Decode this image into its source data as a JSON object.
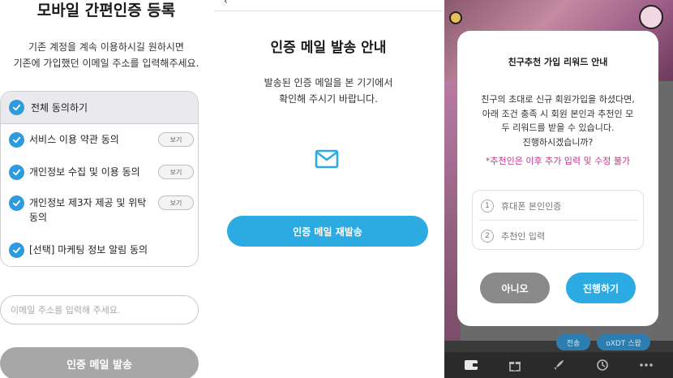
{
  "signup": {
    "title": "모바일 간편인증 등록",
    "desc_line1": "기존 계정을 계속 이용하시길 원하시면",
    "desc_line2": "기존에 가입했던 이메일 주소를 입력해주세요.",
    "agree_all": "전체 동의하기",
    "items": [
      {
        "label": "서비스 이용 약관 동의",
        "view": "보기"
      },
      {
        "label": "개인정보 수집 및 이용 동의",
        "view": "보기"
      },
      {
        "label": "개인정보 제3자 제공 및 위탁 동의",
        "view": "보기"
      },
      {
        "label": "[선택] 마케팅 정보 알림 동의"
      }
    ],
    "email_placeholder": "이메일 주소를 입력해 주세요.",
    "send_button": "인증 메일 발송",
    "check_color": "#2c9be0"
  },
  "mail_sent": {
    "title": "인증 메일 발송 안내",
    "desc_line1": "발송된 인증 메일을 본 기기에서",
    "desc_line2": "확인해 주시기 바랍니다.",
    "icon": "mail-icon",
    "resend_button": "인증 메일 재발송",
    "accent_color": "#2cabe3"
  },
  "referral_modal": {
    "title": "친구추천 가입 리워드 안내",
    "desc_line1": "친구의 초대로 신규 회원가입을 하셨다면,",
    "desc_line2": "아래 조건 충족 시 회원 본인과 추천인 모",
    "desc_line3": "두 리워드를 받을 수 있습니다.",
    "desc_line4": "진행하시겠습니까?",
    "warning": "*추천인은 이후 추가 입력 및 수정 불가",
    "warning_color": "#c0378a",
    "steps": [
      {
        "num": "1",
        "label": "휴대폰 본인인증"
      },
      {
        "num": "2",
        "label": "추천인 입력"
      }
    ],
    "no_button": "아니오",
    "go_button": "진행하기"
  },
  "background_app": {
    "btn_transfer": "전송",
    "btn_swap": "oXDT 스왑",
    "nav_icons": [
      "wallet-icon",
      "gift-icon",
      "rocket-icon",
      "history-icon",
      "more-icon"
    ]
  }
}
